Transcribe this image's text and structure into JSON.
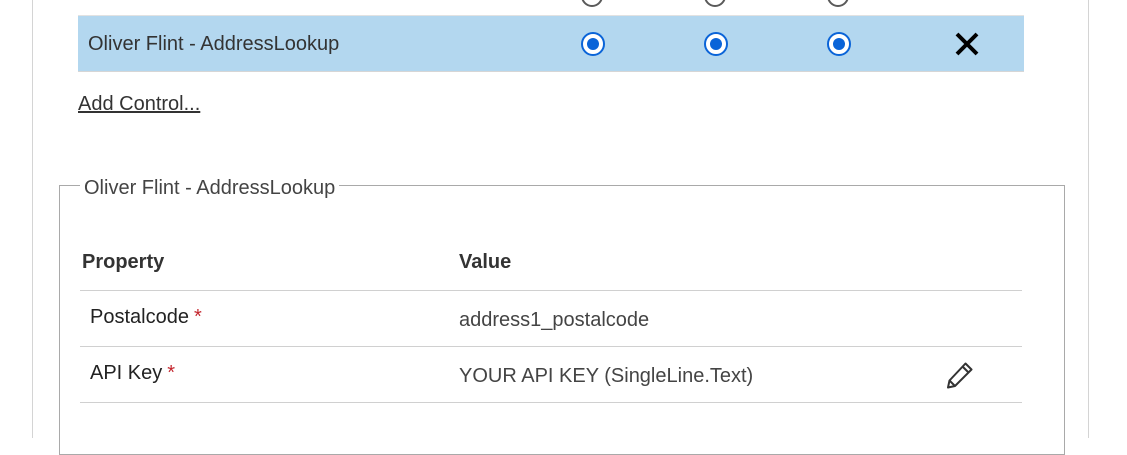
{
  "colors": {
    "selected_row_bg": "#b3d7ef",
    "radio_accent": "#0a64d8",
    "required_marker": "#c4262e"
  },
  "controls": {
    "selected": {
      "name": "Oliver Flint - AddressLookup",
      "web_selected": true,
      "phone_selected": true,
      "tablet_selected": true,
      "remove_icon": "close-icon"
    },
    "add_control_label": "Add Control..."
  },
  "properties_panel": {
    "legend": "Oliver Flint - AddressLookup",
    "headers": {
      "property": "Property",
      "value": "Value"
    },
    "rows": [
      {
        "property": "Postalcode",
        "required_marker": "*",
        "value": "address1_postalcode",
        "editable": false
      },
      {
        "property": "API Key",
        "required_marker": "*",
        "value": "YOUR API KEY (SingleLine.Text)",
        "editable": true,
        "edit_icon": "pencil-icon"
      }
    ]
  }
}
